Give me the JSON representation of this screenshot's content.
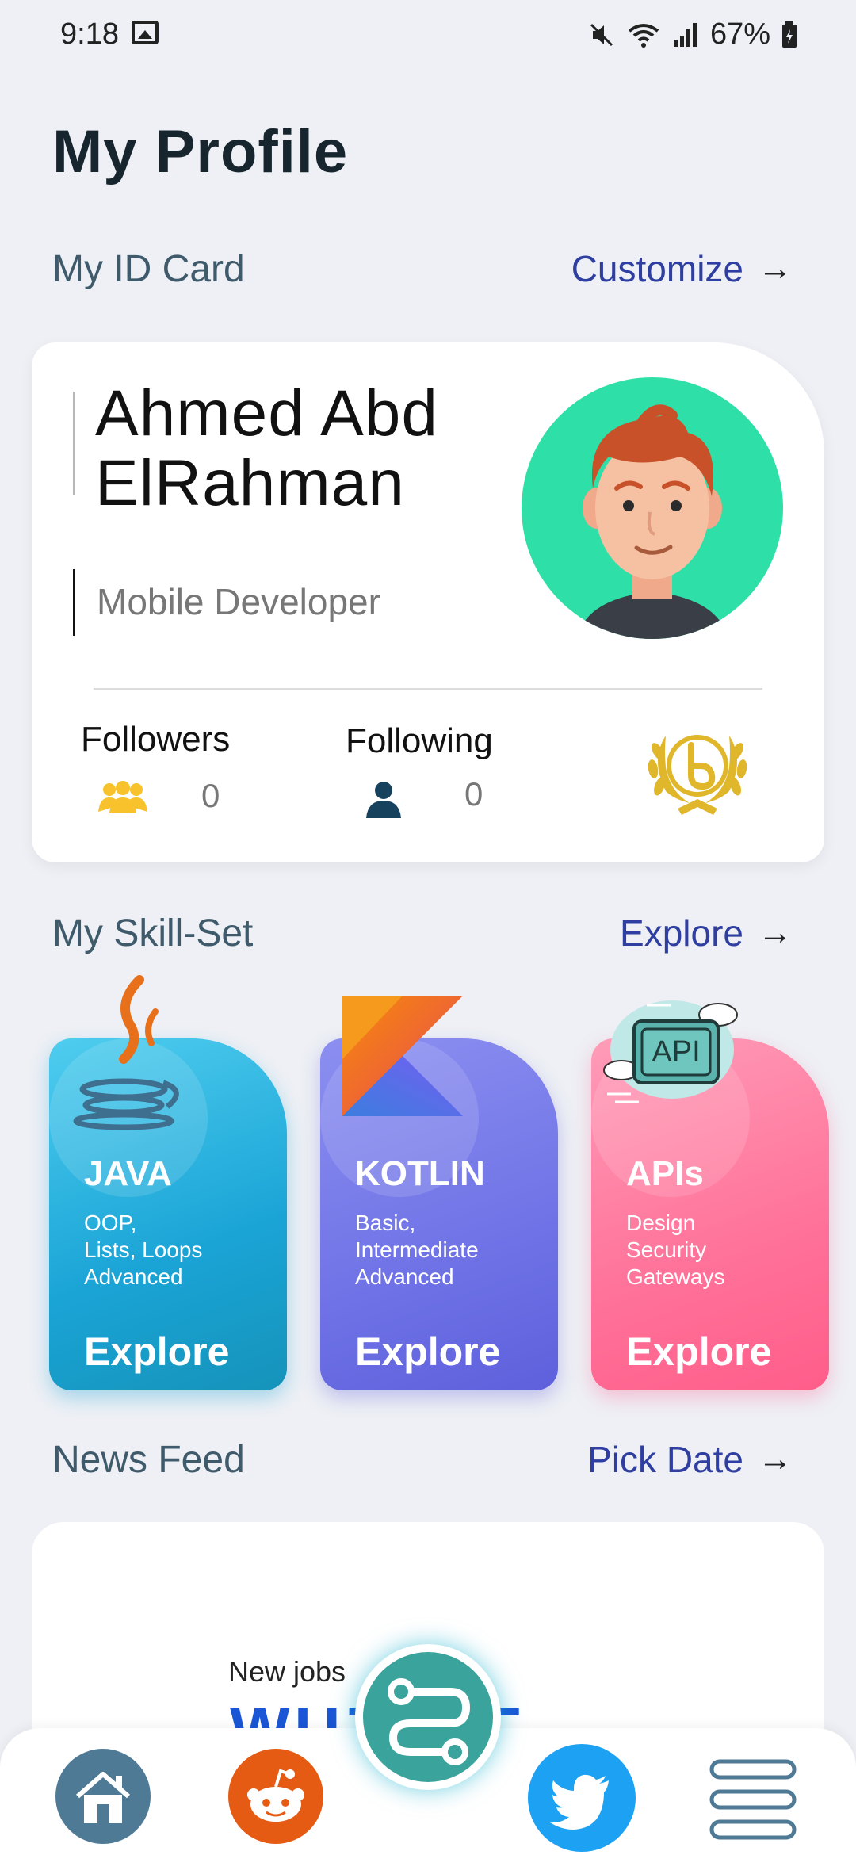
{
  "status_bar": {
    "time": "9:18",
    "battery": "67%"
  },
  "page": {
    "title": "My Profile"
  },
  "id_card_section": {
    "title": "My ID Card",
    "action": "Customize"
  },
  "profile": {
    "name": "Ahmed Abd ElRahman",
    "title": "Mobile Developer",
    "followers_label": "Followers",
    "followers_count": "0",
    "following_label": "Following",
    "following_count": "0"
  },
  "skills_section": {
    "title": "My Skill-Set",
    "action": "Explore",
    "cards": [
      {
        "name": "JAVA",
        "lines": [
          "OOP,",
          "Lists, Loops",
          "Advanced"
        ],
        "action": "Explore",
        "art": "java-logo-icon"
      },
      {
        "name": "KOTLIN",
        "lines": [
          "Basic,",
          "Intermediate",
          "Advanced"
        ],
        "action": "Explore",
        "art": "kotlin-logo-icon"
      },
      {
        "name": "APIs",
        "lines": [
          "Design",
          "Security",
          "Gateways"
        ],
        "action": "Explore",
        "art": "api-cloud-icon",
        "art_text": "API"
      }
    ]
  },
  "news_section": {
    "title": "News Feed",
    "action": "Pick Date",
    "preview_text": "New jobs",
    "preview_brand": "WUZZUF"
  },
  "bottom_nav": [
    "home-icon",
    "reddit-icon",
    "roadmap-icon",
    "twitter-icon",
    "menu-icon"
  ],
  "colors": {
    "accent": "#2f3ea1",
    "java": "#1aa4d6",
    "kotlin": "#6f73e6",
    "apis": "#ff7299",
    "avatar_bg": "#2ee0a7"
  }
}
